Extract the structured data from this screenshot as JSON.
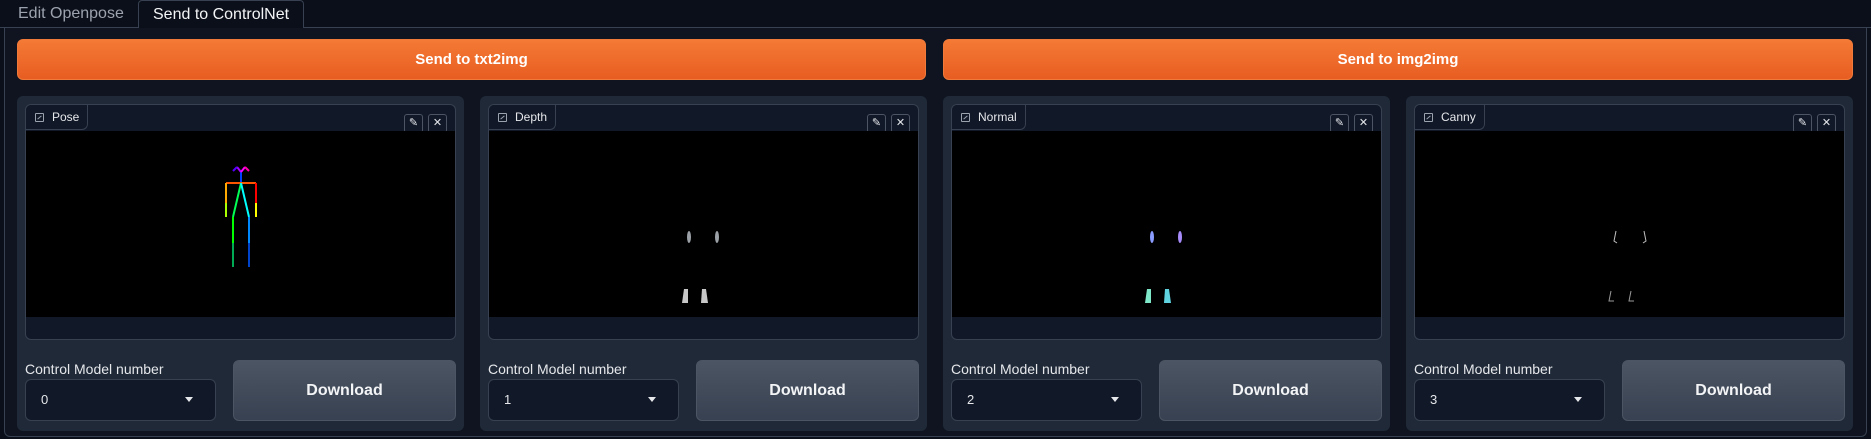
{
  "tabs": [
    {
      "label": "Edit Openpose",
      "active": false
    },
    {
      "label": "Send to ControlNet",
      "active": true
    }
  ],
  "send_buttons": {
    "txt2img": "Send to txt2img",
    "img2img": "Send to img2img"
  },
  "cards": [
    {
      "label": "Pose",
      "control_label": "Control Model number",
      "value": "0",
      "download": "Download"
    },
    {
      "label": "Depth",
      "control_label": "Control Model number",
      "value": "1",
      "download": "Download"
    },
    {
      "label": "Normal",
      "control_label": "Control Model number",
      "value": "2",
      "download": "Download"
    },
    {
      "label": "Canny",
      "control_label": "Control Model number",
      "value": "3",
      "download": "Download"
    }
  ],
  "icons": {
    "image": "image-icon",
    "edit": "pencil-icon",
    "clear": "close-icon",
    "dropdown": "chevron-down-icon"
  },
  "colors": {
    "accent": "#f06a2b",
    "background": "#0b0f19",
    "card": "#1f2937"
  }
}
